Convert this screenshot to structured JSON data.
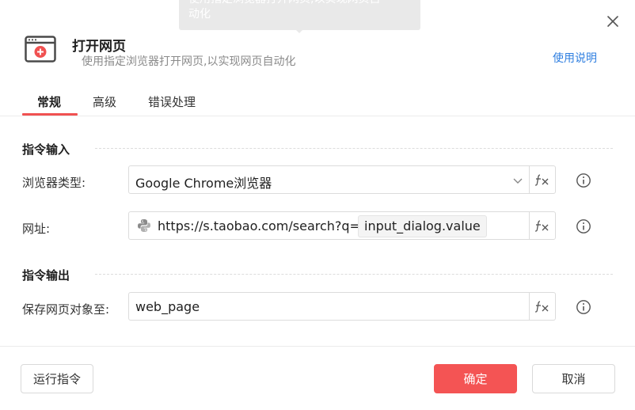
{
  "tooltip": {
    "line1": "使用指定浏览器打开网页,以实现网页自",
    "line2": "动化"
  },
  "header": {
    "title": "打开网页",
    "subtitle": "使用指定浏览器打开网页,以实现网页自动化",
    "help_link": "使用说明",
    "icon": "browser-window-icon"
  },
  "tabs": [
    {
      "label": "常规",
      "active": true
    },
    {
      "label": "高级",
      "active": false
    },
    {
      "label": "错误处理",
      "active": false
    }
  ],
  "sections": {
    "input_title": "指令输入",
    "output_title": "指令输出"
  },
  "fields": {
    "browser_type": {
      "label": "浏览器类型:",
      "value": "Google Chrome浏览器"
    },
    "url": {
      "label": "网址:",
      "value_prefix": "https://s.taobao.com/search?q=",
      "variable": "input_dialog.value"
    },
    "save_to": {
      "label": "保存网页对象至:",
      "value": "web_page"
    }
  },
  "fx_label": "fx",
  "footer": {
    "run_label": "运行指令",
    "ok_label": "确定",
    "cancel_label": "取消"
  },
  "colors": {
    "accent": "#f45454",
    "link": "#2f7fe0"
  }
}
